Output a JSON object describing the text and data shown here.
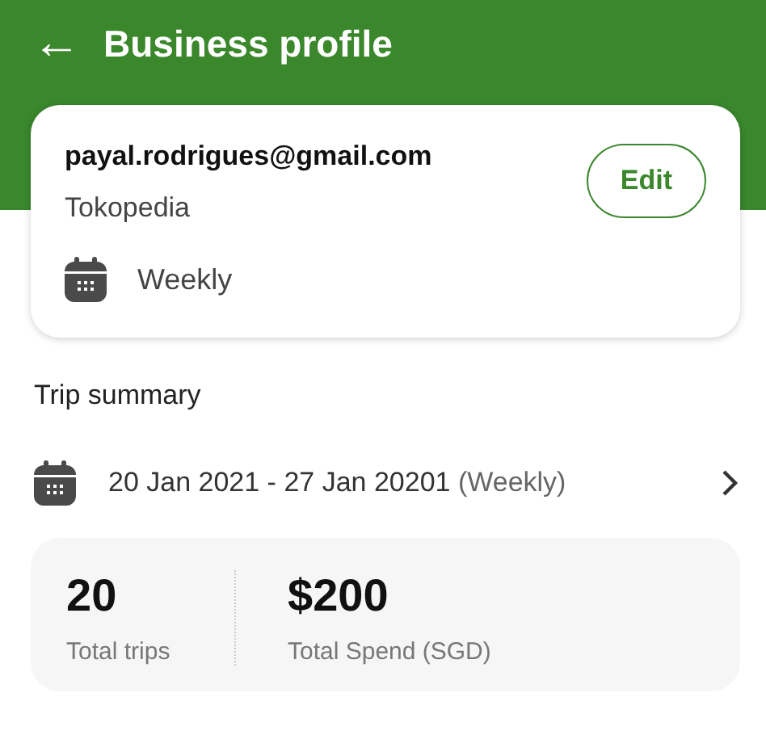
{
  "header": {
    "back": "←",
    "title": "Business profile"
  },
  "profile": {
    "email": "payal.rodrigues@gmail.com",
    "company": "Tokopedia",
    "frequency": "Weekly",
    "edit_button": "Edit"
  },
  "trip_summary": {
    "heading": "Trip summary",
    "period": "20 Jan 2021 - 27 Jan 20201",
    "period_suffix": "(Weekly)",
    "stats": [
      {
        "value": "20",
        "label": "Total trips"
      },
      {
        "value": "$200",
        "label": "Total Spend (SGD)"
      }
    ]
  }
}
